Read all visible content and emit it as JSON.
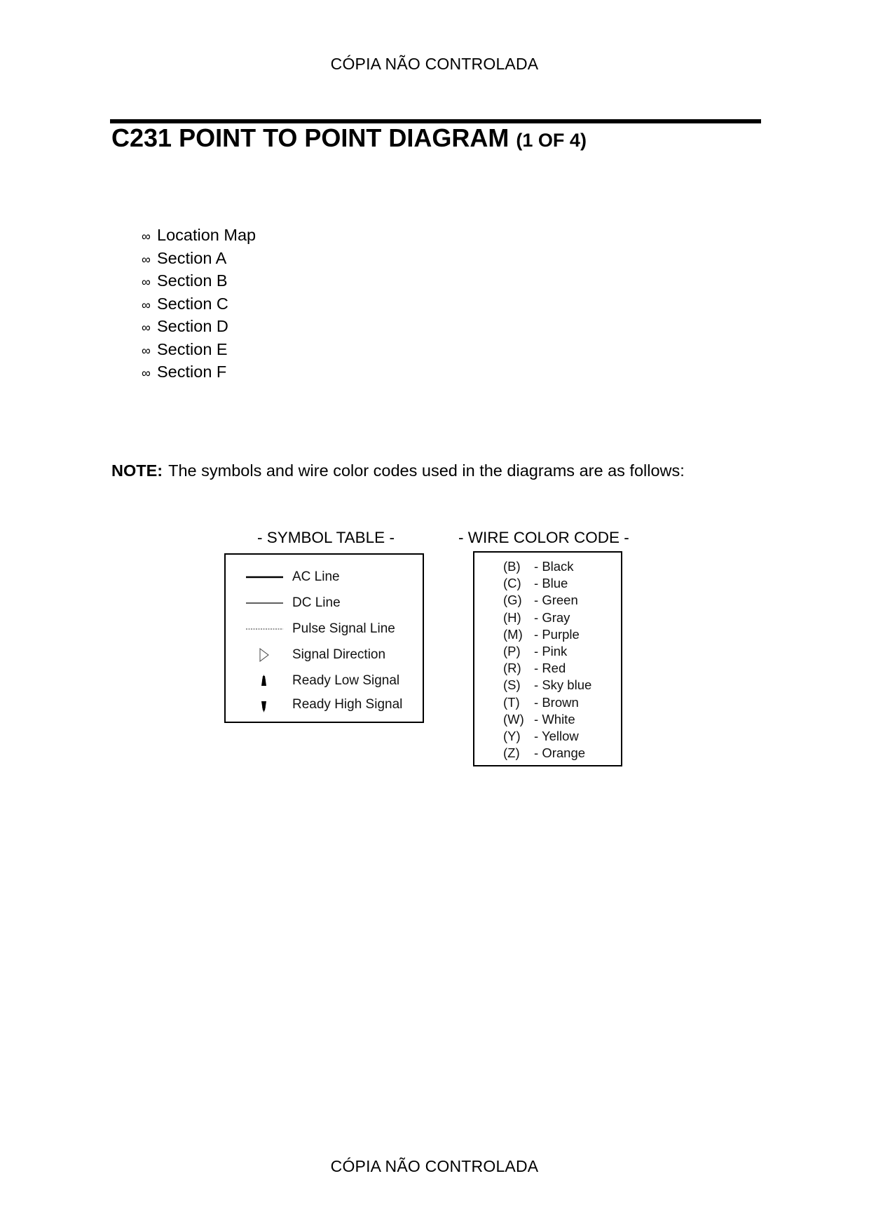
{
  "header": {
    "stamp": "CÓPIA NÃO CONTROLADA"
  },
  "title": {
    "main": "C231 POINT TO POINT DIAGRAM",
    "sub": "(1 OF 4)"
  },
  "toc": {
    "bullet_icon": "∞",
    "items": [
      "Location Map",
      "Section A",
      "Section B",
      "Section C",
      "Section D",
      "Section E",
      "Section F"
    ]
  },
  "note": {
    "label": "NOTE:",
    "text": "The symbols and wire color codes used in the diagrams are as follows:"
  },
  "symbol_table": {
    "heading": "- SYMBOL TABLE -",
    "rows": [
      {
        "icon": "ac-line-thick-solid",
        "label": "AC Line"
      },
      {
        "icon": "dc-line-thin-solid",
        "label": "DC Line"
      },
      {
        "icon": "pulse-line-dotted",
        "label": "Pulse Signal Line"
      },
      {
        "icon": "hollow-triangle-right",
        "label": "Signal Direction"
      },
      {
        "icon": "filled-triangle-up",
        "label": "Ready Low Signal"
      },
      {
        "icon": "filled-triangle-down",
        "label": "Ready High Signal"
      }
    ]
  },
  "wire_color_code": {
    "heading": "- WIRE COLOR CODE -",
    "items": [
      {
        "code": "(B)",
        "color": "Black"
      },
      {
        "code": "(C)",
        "color": "Blue"
      },
      {
        "code": "(G)",
        "color": "Green"
      },
      {
        "code": "(H)",
        "color": "Gray"
      },
      {
        "code": "(M)",
        "color": "Purple"
      },
      {
        "code": "(P)",
        "color": "Pink"
      },
      {
        "code": "(R)",
        "color": "Red"
      },
      {
        "code": "(S)",
        "color": "Sky blue"
      },
      {
        "code": "(T)",
        "color": "Brown"
      },
      {
        "code": "(W)",
        "color": "White"
      },
      {
        "code": "(Y)",
        "color": "Yellow"
      },
      {
        "code": "(Z)",
        "color": "Orange"
      }
    ]
  },
  "footer": {
    "stamp": "CÓPIA NÃO CONTROLADA"
  }
}
